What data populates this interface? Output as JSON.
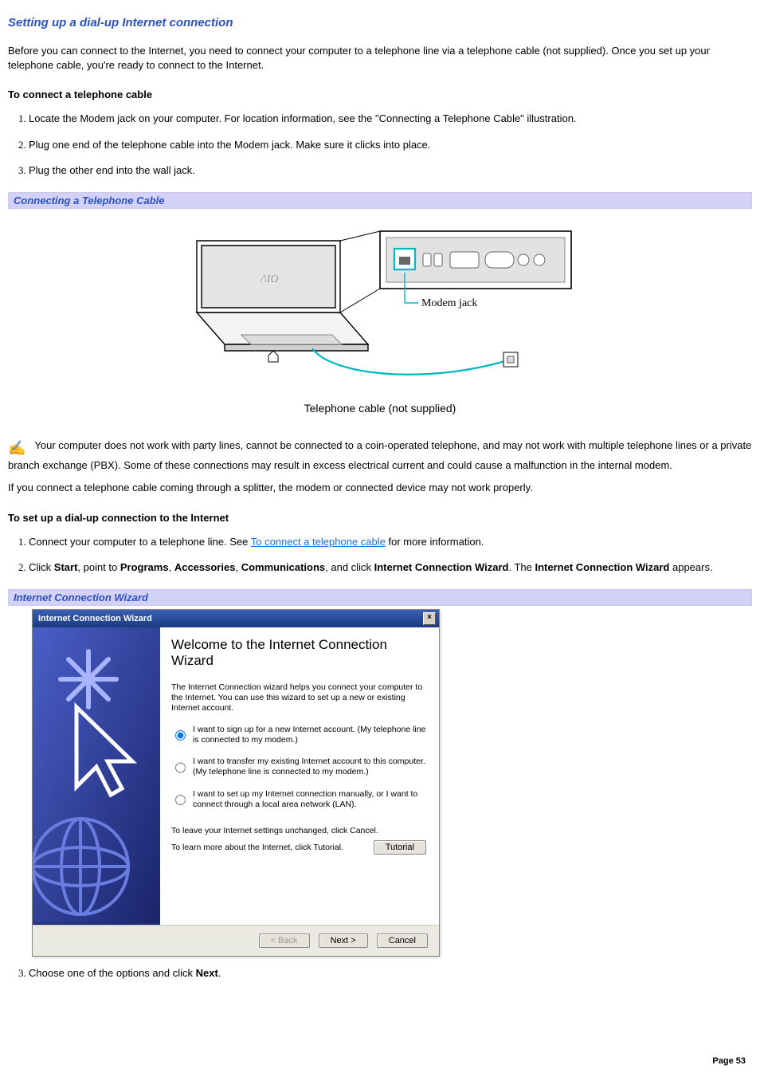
{
  "title": "Setting up a dial-up Internet connection",
  "intro": "Before you can connect to the Internet, you need to connect your computer to a telephone line via a telephone cable (not supplied). Once you set up your telephone cable, you're ready to connect to the Internet.",
  "sub1_title": "To connect a telephone cable",
  "sub1_steps": [
    "Locate the Modem jack on your computer. For location information, see the \"Connecting a Telephone Cable\" illustration.",
    "Plug one end of the telephone cable into the Modem jack. Make sure it clicks into place.",
    "Plug the other end into the wall jack."
  ],
  "caption1": "Connecting a Telephone Cable",
  "illu_label1": "Modem jack",
  "illu_label2": "Telephone cable (not supplied)",
  "note_text": "Your computer does not work with party lines, cannot be connected to a coin-operated telephone, and may not work with multiple telephone lines or a private branch exchange (PBX). Some of these connections may result in excess electrical current and could cause a malfunction in the internal modem.",
  "splitter_text": "If you connect a telephone cable coming through a splitter, the modem or connected device may not work properly.",
  "sub2_title": "To set up a dial-up connection to the Internet",
  "sub2_step1_a": "Connect your computer to a telephone line. See ",
  "sub2_step1_link": "To connect a telephone cable",
  "sub2_step1_b": " for more information.",
  "sub2_step2_pre": "Click ",
  "sub2_step2_start": "Start",
  "sub2_step2_mid1": ", point to ",
  "sub2_step2_programs": "Programs",
  "sub2_step2_sep": ", ",
  "sub2_step2_acc": "Accessories",
  "sub2_step2_comm": "Communications",
  "sub2_step2_mid2": ", and click ",
  "sub2_step2_icw": "Internet Connection Wizard",
  "sub2_step2_post1": ". The ",
  "sub2_step2_post2": " appears.",
  "caption2": "Internet Connection Wizard",
  "wizard": {
    "title": "Internet Connection Wizard",
    "close": "×",
    "heading": "Welcome to the Internet Connection Wizard",
    "desc": "The Internet Connection wizard helps you connect your computer to the Internet.  You can use this wizard to set up a new or existing Internet account.",
    "opt1": "I want to sign up for a new Internet account. (My telephone line is connected to my modem.)",
    "opt2": "I want to transfer my existing Internet account to this computer. (My telephone line is connected to my modem.)",
    "opt3": "I want to set up my Internet connection manually, or I want to connect through a local area network (LAN).",
    "leave": "To leave your Internet settings unchanged, click Cancel.",
    "learn": "To learn more about the Internet, click Tutorial.",
    "tutorial_btn": "Tutorial",
    "back_btn": "< Back",
    "next_btn": "Next >",
    "cancel_btn": "Cancel"
  },
  "sub2_step3_a": "Choose one of the options and click ",
  "sub2_step3_bold": "Next",
  "sub2_step3_b": ".",
  "page_number": "Page 53"
}
